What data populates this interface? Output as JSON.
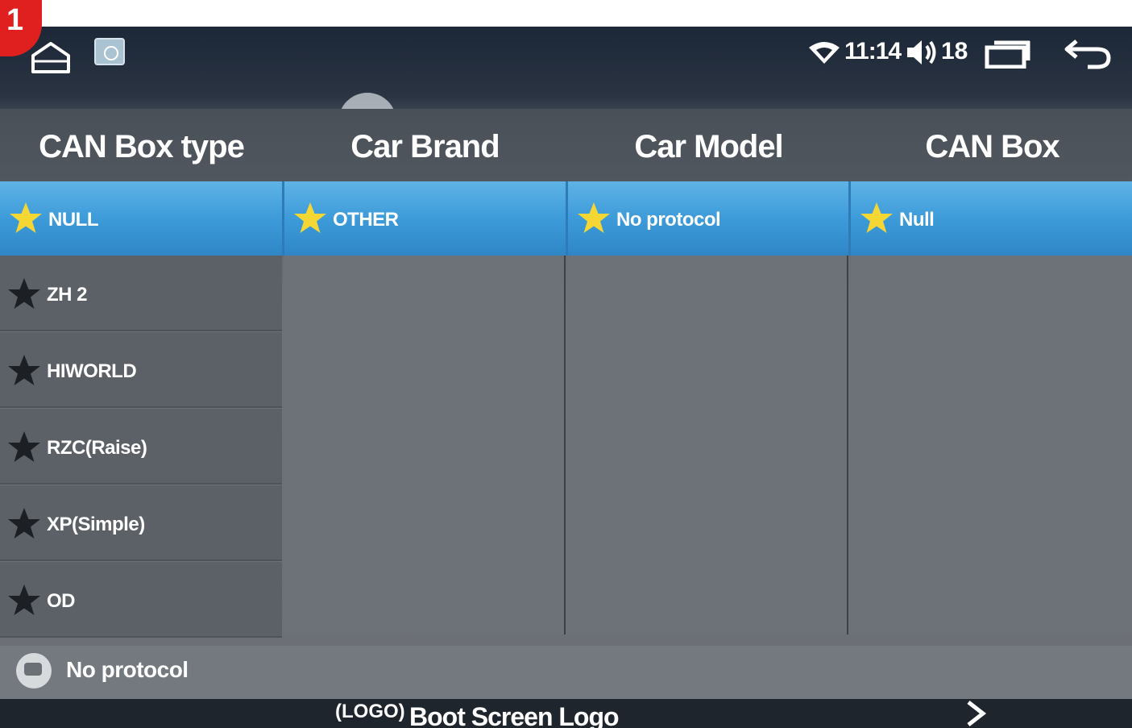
{
  "step_number": "1",
  "status_bar": {
    "time": "11:14",
    "volume": "18",
    "icons": [
      "home-icon",
      "app-icon",
      "wifi-icon",
      "volume-icon",
      "recent-apps-icon",
      "back-icon"
    ]
  },
  "columns": [
    {
      "header": "CAN Box type",
      "selected": "NULL"
    },
    {
      "header": "Car Brand",
      "selected": "OTHER"
    },
    {
      "header": "Car Model",
      "selected": "No protocol"
    },
    {
      "header": "CAN Box",
      "selected": "Null"
    }
  ],
  "can_box_types": [
    "ZH 2",
    "HIWORLD",
    "RZC(Raise)",
    "XP(Simple)",
    "OD"
  ],
  "protocol_status": "No protocol",
  "boot_logo": {
    "badge": "(LOGO)",
    "label": "Boot Screen Logo"
  },
  "colors": {
    "selected_row": "#3d9bd9",
    "selected_star": "#f6d632",
    "unselected_star": "#1c1f24",
    "header_bg": "#4d535b"
  }
}
